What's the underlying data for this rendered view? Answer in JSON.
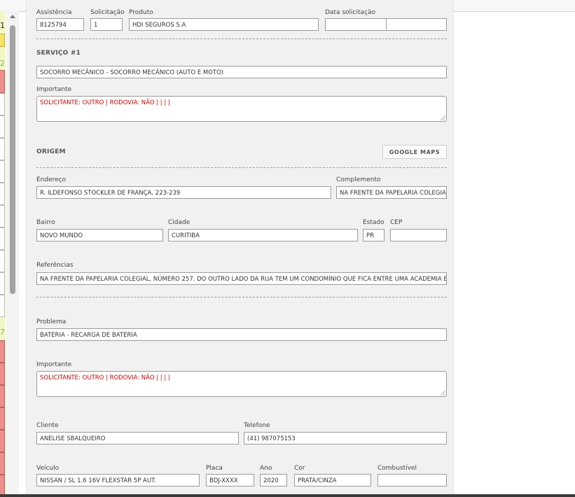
{
  "left_column": {
    "numbers": [
      "1",
      "2",
      "7"
    ]
  },
  "request": {
    "assistencia_label": "Assistência",
    "assistencia_value": "8125794",
    "solicitacao_label": "Solicitação",
    "solicitacao_value": "1",
    "produto_label": "Produto",
    "produto_value": "HDI SEGUROS S.A",
    "data_label": "Data solicitação",
    "data_value": "",
    "data_time_value": ""
  },
  "service": {
    "heading": "SERVIÇO #1",
    "service_value": "SOCORRO MECÂNICO - SOCORRO MECÂNICO (AUTO E MOTO)",
    "importante_label": "Importante",
    "importante_value": "SOLICITANTE: OUTRO | RODOVIA: NÃO |  |  |  |"
  },
  "origin": {
    "heading": "ORIGEM",
    "maps_button": "GOOGLE MAPS",
    "endereco_label": "Endereço",
    "endereco_value": "R. ILDEFONSO STOCKLER DE FRANÇA, 223-239",
    "complemento_label": "Complemento",
    "complemento_value": "NA FRENTE DA PAPELARIA COLEGIAL",
    "bairro_label": "Bairro",
    "bairro_value": "NOVO MUNDO",
    "cidade_label": "Cidade",
    "cidade_value": "CURITIBA",
    "estado_label": "Estado",
    "estado_value": "PR",
    "cep_label": "CEP",
    "cep_value": "",
    "referencias_label": "Referências",
    "referencias_value": "NA FRENTE DA PAPELARIA COLEGIAL, NÚMERO 257. DO OUTRO LADO DA RUA TEM UM CONDOMÍNIO QUE FICA ENTRE UMA ACADEMIA E UM"
  },
  "problem": {
    "problema_label": "Problema",
    "problema_value": "BATERIA - RECARGA DE BATERIA",
    "importante_label": "Importante",
    "importante_value": "SOLICITANTE: OUTRO | RODOVIA: NÃO |  |  |  |"
  },
  "client": {
    "cliente_label": "Cliente",
    "cliente_value": "ANELISE SBALQUEIRO",
    "telefone_label": "Telefone",
    "telefone_value": "(41) 987075153"
  },
  "vehicle": {
    "veiculo_label": "Veículo",
    "veiculo_value": "NISSAN / SL 1.6 16V FLEXSTAR 5P AUT.",
    "placa_label": "Placa",
    "placa_value": "BDJ-XXXX",
    "ano_label": "Ano",
    "ano_value": "2020",
    "cor_label": "Cor",
    "cor_value": "PRATA/CINZA",
    "combustivel_label": "Combustível",
    "combustivel_value": ""
  }
}
